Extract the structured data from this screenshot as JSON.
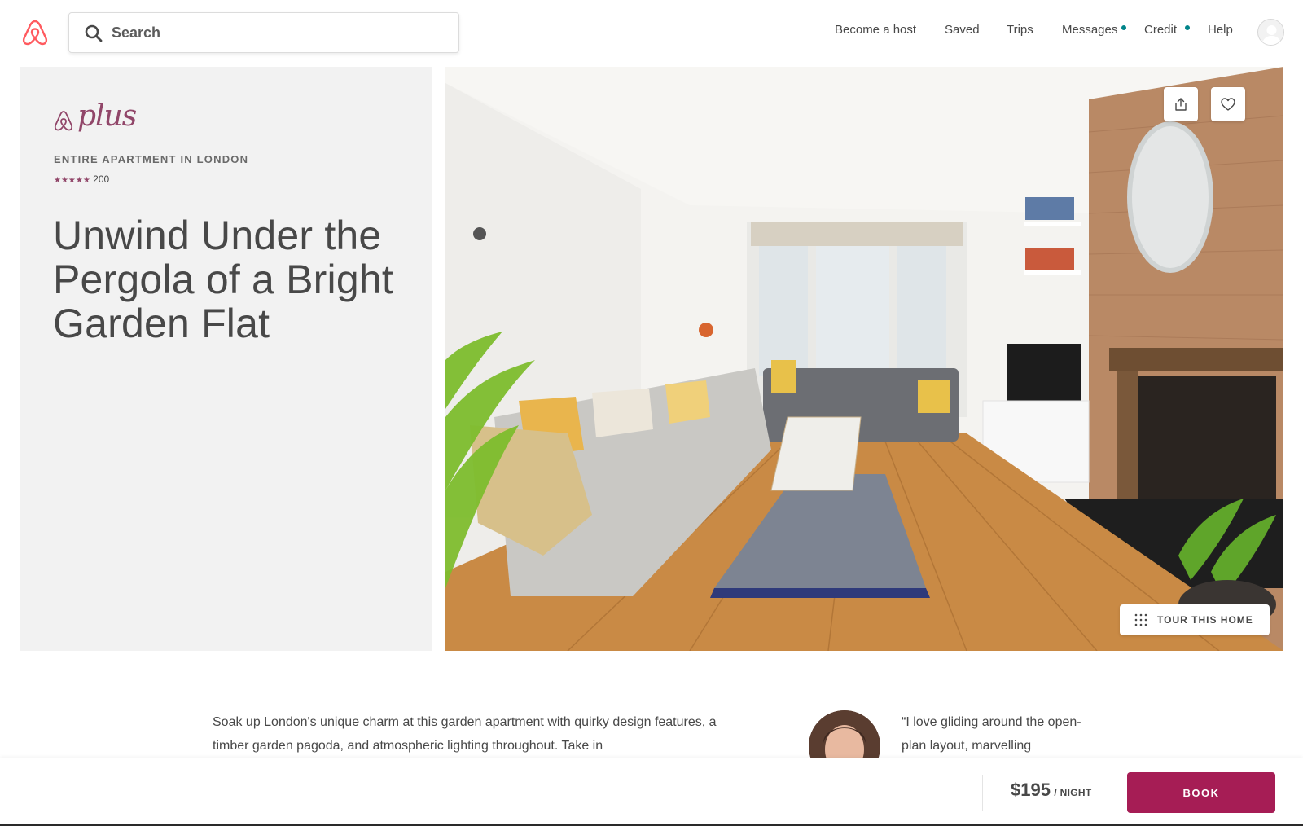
{
  "header": {
    "search_placeholder": "Search",
    "nav": [
      {
        "label": "Become a host",
        "has_dot": false
      },
      {
        "label": "Saved",
        "has_dot": false
      },
      {
        "label": "Trips",
        "has_dot": false
      },
      {
        "label": "Messages",
        "has_dot": true
      },
      {
        "label": "Credit",
        "has_dot": true
      },
      {
        "label": "Help",
        "has_dot": false
      }
    ]
  },
  "listing": {
    "badge": "plus",
    "kicker": "ENTIRE APARTMENT IN LONDON",
    "stars": "★★★★★",
    "review_count": "200",
    "title": "Unwind Under the Pergola of a Bright Garden Flat"
  },
  "hero": {
    "share_icon": "share-icon",
    "save_icon": "heart-icon",
    "tour_label": "TOUR THIS HOME"
  },
  "description": {
    "text": "Soak up London's unique charm at this garden apartment with quirky design features, a timber garden pagoda, and atmospheric lighting throughout. Take in",
    "quote": "“I love gliding around the open-plan layout, marvelling"
  },
  "booking": {
    "price": "$195",
    "per": "/ NIGHT",
    "book_label": "BOOK"
  },
  "colors": {
    "brand_plus": "#914669",
    "book_button": "#a61d55",
    "notification_dot": "#008489",
    "airbnb_logo": "#ff5a5f"
  }
}
